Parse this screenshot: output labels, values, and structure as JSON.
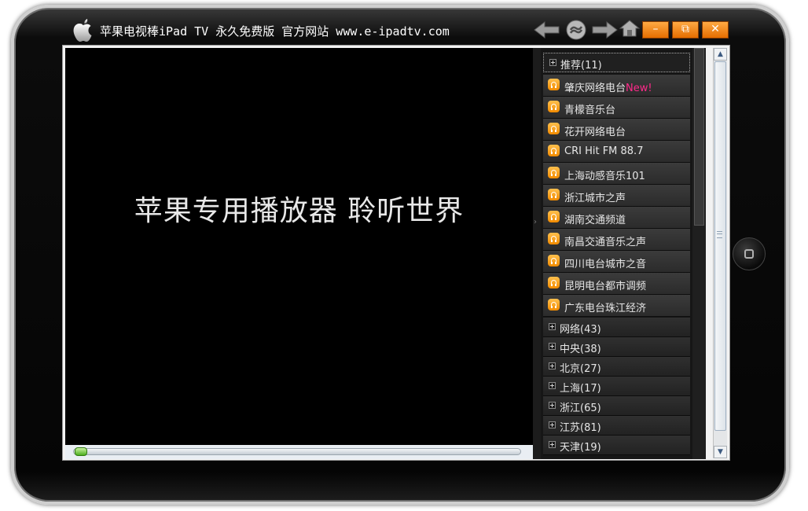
{
  "window": {
    "title": "苹果电视棒iPad TV 永久免费版 官方网站 www.e-ipadtv.com",
    "buttons": {
      "minimize": "–",
      "restore": "⧉",
      "close": "✕"
    }
  },
  "player": {
    "overlay_text": "苹果专用播放器 聆听世界",
    "progress": 0.02
  },
  "channel_list": {
    "categories_top": [
      {
        "label": "推荐(11)",
        "expanded": true
      }
    ],
    "stations": [
      {
        "name": "肇庆网络电台",
        "badge": "New!"
      },
      {
        "name": "青檬音乐台",
        "badge": ""
      },
      {
        "name": "花开网络电台",
        "badge": ""
      },
      {
        "name": "CRI Hit FM 88.7",
        "badge": ""
      },
      {
        "name": "上海动感音乐101",
        "badge": ""
      },
      {
        "name": "浙江城市之声",
        "badge": ""
      },
      {
        "name": "湖南交通频道",
        "badge": ""
      },
      {
        "name": "南昌交通音乐之声",
        "badge": ""
      },
      {
        "name": "四川电台城市之音",
        "badge": ""
      },
      {
        "name": "昆明电台都市调频",
        "badge": ""
      },
      {
        "name": "广东电台珠江经济",
        "badge": ""
      }
    ],
    "categories": [
      {
        "label": "网络(43)"
      },
      {
        "label": "中央(38)"
      },
      {
        "label": "北京(27)"
      },
      {
        "label": "上海(17)"
      },
      {
        "label": "浙江(65)"
      },
      {
        "label": "江苏(81)"
      },
      {
        "label": "天津(19)"
      }
    ]
  },
  "colors": {
    "accent": "#f18a00",
    "new_badge": "#ff2a8a",
    "panel_bg": "#161616"
  }
}
